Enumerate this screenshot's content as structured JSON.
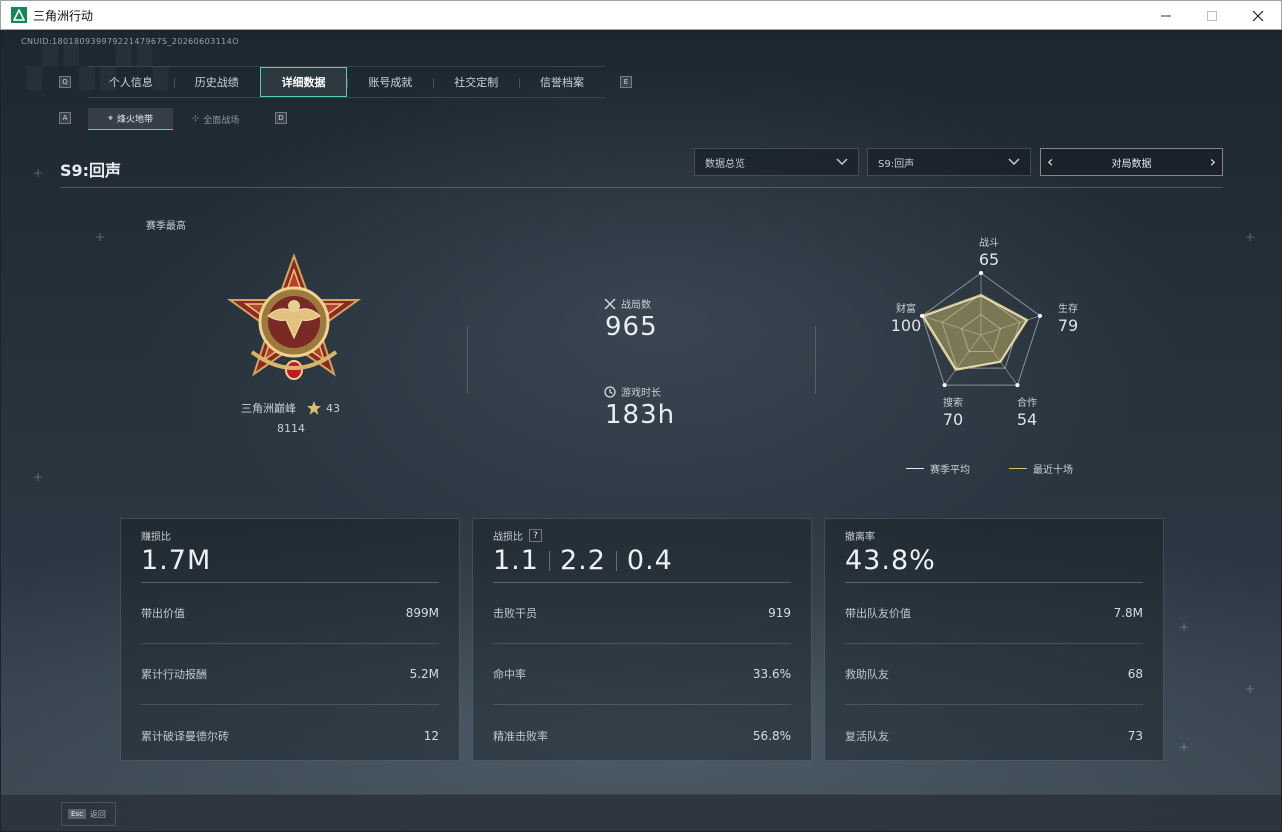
{
  "window": {
    "title": "三角洲行动",
    "controls": [
      "minimize",
      "maximize",
      "close"
    ]
  },
  "cnuid": "CNUID:18018093997922147967S_20260603114O",
  "nav": {
    "tabs": [
      "个人信息",
      "历史战绩",
      "详细数据",
      "账号成就",
      "社交定制",
      "信誉档案"
    ],
    "active_tab": "详细数据",
    "left_key": "Q",
    "right_key": "E"
  },
  "subnav": {
    "tabs": [
      "烽火地带",
      "全面战场"
    ],
    "active": "烽火地带",
    "left_key": "A",
    "right_key": "D"
  },
  "header": {
    "season_title": "S9:回声",
    "dropdown_mode": "数据总览",
    "dropdown_season": "S9:回声",
    "pager_label": "对局数据"
  },
  "rank": {
    "label": "赛季最高",
    "name": "三角洲巅峰",
    "stars": "43",
    "points": "8114"
  },
  "stats": {
    "matches_label": "战局数",
    "matches_value": "965",
    "playtime_label": "游戏时长",
    "playtime_value": "183h"
  },
  "radar": {
    "axes": [
      {
        "label": "战斗",
        "value": "65"
      },
      {
        "label": "生存",
        "value": "79"
      },
      {
        "label": "合作",
        "value": "54"
      },
      {
        "label": "搜索",
        "value": "70"
      },
      {
        "label": "财富",
        "value": "100"
      }
    ],
    "legend_season": "赛季平均",
    "legend_recent": "最近十场",
    "color_season": "#e6e9ec",
    "color_recent": "#d9c56a"
  },
  "cards": [
    {
      "label": "赚损比",
      "big": "1.7M",
      "rows": [
        {
          "label": "带出价值",
          "value": "899M"
        },
        {
          "label": "累计行动报酬",
          "value": "5.2M"
        },
        {
          "label": "累计破译曼德尔砖",
          "value": "12"
        }
      ]
    },
    {
      "label": "战损比",
      "help": "?",
      "big_values": [
        "1.1",
        "2.2",
        "0.4"
      ],
      "rows": [
        {
          "label": "击败干员",
          "value": "919"
        },
        {
          "label": "命中率",
          "value": "33.6%"
        },
        {
          "label": "精准击败率",
          "value": "56.8%"
        }
      ]
    },
    {
      "label": "撤离率",
      "big": "43.8%",
      "rows": [
        {
          "label": "带出队友价值",
          "value": "7.8M"
        },
        {
          "label": "救助队友",
          "value": "68"
        },
        {
          "label": "复活队友",
          "value": "73"
        }
      ]
    }
  ],
  "footer": {
    "esc_key": "Esc",
    "esc_label": "返回"
  }
}
